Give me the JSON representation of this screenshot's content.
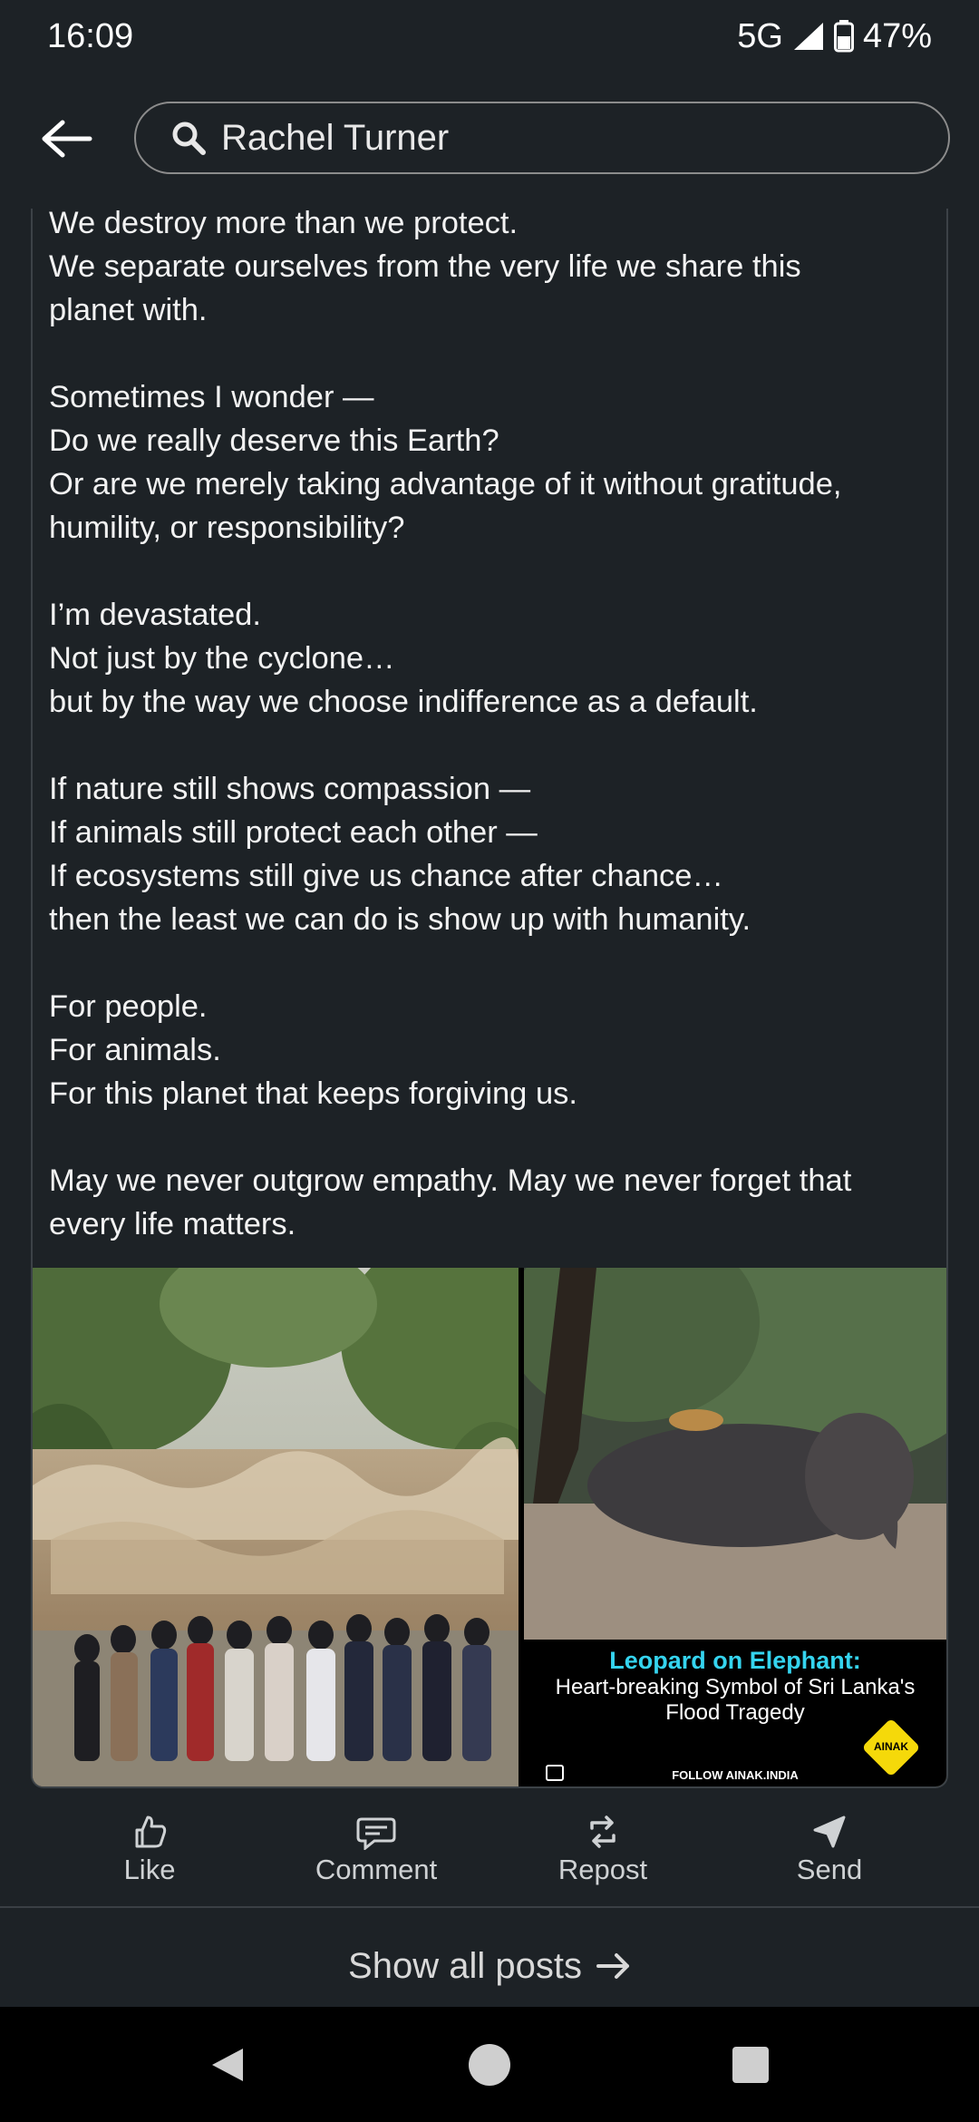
{
  "status": {
    "time": "16:09",
    "network": "5G",
    "battery": "47%"
  },
  "search": {
    "query": "Rachel Turner"
  },
  "post": {
    "paragraphs": [
      [
        "We destroy more than we protect.",
        "We separate ourselves from the very life we share this",
        "planet with."
      ],
      [
        "Sometimes I wonder —",
        "Do we really deserve this Earth?",
        "Or are we merely taking advantage of it without gratitude,",
        "humility, or responsibility?"
      ],
      [
        "I’m devastated.",
        "Not just by the cyclone…",
        "but by the way we choose indifference as a default."
      ],
      [
        "If nature still shows compassion —",
        "If animals still protect each other —",
        "If ecosystems still give us chance after chance…",
        "then the least we can do is show up with humanity."
      ],
      [
        "For people.",
        "For animals.",
        "For this planet that keeps forgiving us."
      ],
      [
        "May we never outgrow empathy. May we never forget that",
        "every life matters."
      ]
    ],
    "image_right": {
      "headline": "Leopard on Elephant:",
      "subline1": "Heart-breaking Symbol of Sri Lanka's",
      "subline2": "Flood Tragedy",
      "footer": "FOLLOW AINAK.INDIA",
      "logo": "AINAK"
    }
  },
  "actions": {
    "like": "Like",
    "comment": "Comment",
    "repost": "Repost",
    "send": "Send"
  },
  "show_all": "Show all posts"
}
